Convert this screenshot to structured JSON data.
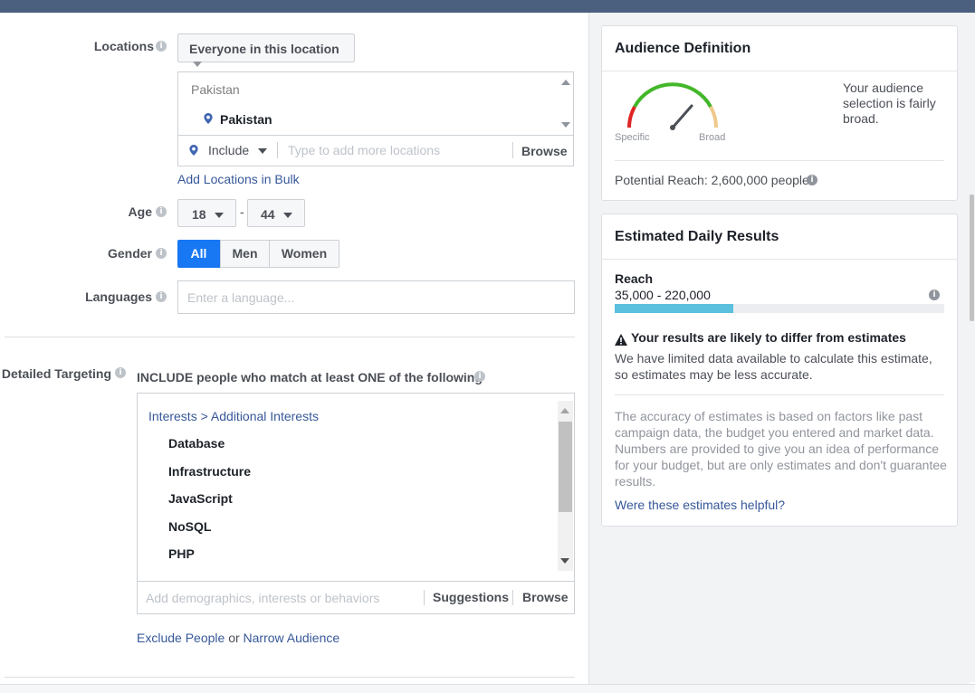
{
  "locations": {
    "label": "Locations",
    "mode": "Everyone in this location",
    "group_header": "Pakistan",
    "selected": "Pakistan",
    "include_label": "Include",
    "input_placeholder": "Type to add more locations",
    "browse_label": "Browse",
    "bulk_link": "Add Locations in Bulk"
  },
  "age": {
    "label": "Age",
    "min": "18",
    "separator": "-",
    "max": "44"
  },
  "gender": {
    "label": "Gender",
    "options": [
      "All",
      "Men",
      "Women"
    ],
    "selected": "All"
  },
  "languages": {
    "label": "Languages",
    "placeholder": "Enter a language..."
  },
  "detailed_targeting": {
    "label": "Detailed Targeting",
    "include_text": "INCLUDE people who match at least ONE of the following",
    "breadcrumb_root": "Interests",
    "breadcrumb_sep": ">",
    "breadcrumb_leaf": "Additional Interests",
    "items": [
      "Database",
      "Infrastructure",
      "JavaScript",
      "NoSQL",
      "PHP"
    ],
    "input_placeholder": "Add demographics, interests or behaviors",
    "suggestions_label": "Suggestions",
    "browse_label": "Browse",
    "exclude_link": "Exclude People",
    "or_text": "or",
    "narrow_link": "Narrow Audience"
  },
  "audience_definition": {
    "title": "Audience Definition",
    "gauge_left": "Specific",
    "gauge_right": "Broad",
    "description": "Your audience selection is fairly broad.",
    "potential_reach": "Potential Reach: 2,600,000 people"
  },
  "estimated_daily": {
    "title": "Estimated Daily Results",
    "reach_label": "Reach",
    "reach_range": "35,000 - 220,000",
    "reach_bar_fraction": 0.36,
    "warning_title": "Your results are likely to differ from estimates",
    "warning_body": "We have limited data available to calculate this estimate, so estimates may be less accurate.",
    "accuracy_note": "The accuracy of estimates is based on factors like past campaign data, the budget you entered and market data. Numbers are provided to give you an idea of performance for your budget, but are only estimates and don't guarantee results.",
    "feedback_link": "Were these estimates helpful?"
  },
  "colors": {
    "primary": "#1877f2",
    "link": "#365899",
    "reach_bar": "#5bc0de",
    "gauge_green": "#42b72a",
    "gauge_red": "#e02424",
    "gauge_tan": "#f0c88a"
  }
}
